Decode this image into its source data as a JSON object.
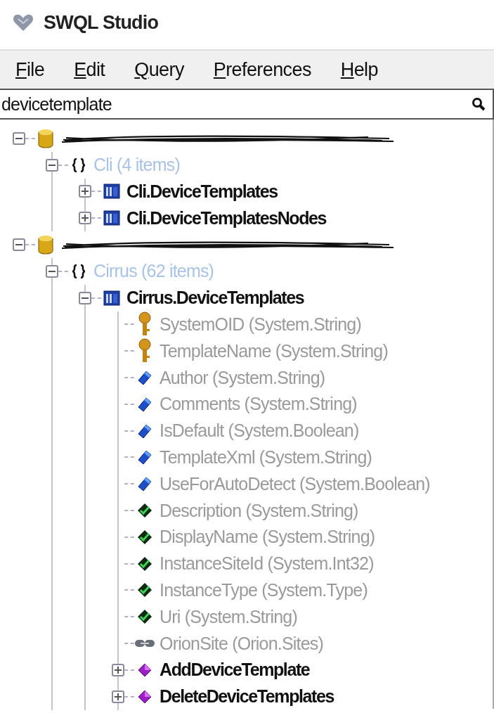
{
  "window": {
    "title": "SWQL Studio"
  },
  "menu": [
    {
      "label": "File"
    },
    {
      "label": "Edit"
    },
    {
      "label": "Query"
    },
    {
      "label": "Preferences"
    },
    {
      "label": "Help"
    }
  ],
  "search": {
    "value": "devicetemplate"
  },
  "tree": [
    {
      "kind": "server",
      "expanded": true,
      "children": [
        {
          "kind": "namespace",
          "label": "Cli (4 items)",
          "expanded": true,
          "children": [
            {
              "kind": "entity",
              "label": "Cli.DeviceTemplates",
              "expanded": false
            },
            {
              "kind": "entity",
              "label": "Cli.DeviceTemplatesNodes",
              "expanded": false
            }
          ]
        }
      ]
    },
    {
      "kind": "server",
      "expanded": true,
      "children": [
        {
          "kind": "namespace",
          "label": "Cirrus (62 items)",
          "expanded": true,
          "children": [
            {
              "kind": "entity",
              "label": "Cirrus.DeviceTemplates",
              "expanded": true,
              "children": [
                {
                  "kind": "key",
                  "label": "SystemOID (System.String)"
                },
                {
                  "kind": "key",
                  "label": "TemplateName (System.String)"
                },
                {
                  "kind": "property",
                  "label": "Author (System.String)"
                },
                {
                  "kind": "property",
                  "label": "Comments (System.String)"
                },
                {
                  "kind": "property",
                  "label": "IsDefault (System.Boolean)"
                },
                {
                  "kind": "property",
                  "label": "TemplateXml (System.String)"
                },
                {
                  "kind": "property",
                  "label": "UseForAutoDetect (System.Boolean)"
                },
                {
                  "kind": "inherited",
                  "label": "Description (System.String)"
                },
                {
                  "kind": "inherited",
                  "label": "DisplayName (System.String)"
                },
                {
                  "kind": "inherited",
                  "label": "InstanceSiteId (System.Int32)"
                },
                {
                  "kind": "inherited",
                  "label": "InstanceType (System.Type)"
                },
                {
                  "kind": "inherited",
                  "label": "Uri (System.String)"
                },
                {
                  "kind": "navigation",
                  "label": "OrionSite (Orion.Sites)"
                },
                {
                  "kind": "verb",
                  "label": "AddDeviceTemplate",
                  "expanded": false
                },
                {
                  "kind": "verb",
                  "label": "DeleteDeviceTemplates",
                  "expanded": false
                }
              ]
            }
          ]
        }
      ]
    }
  ]
}
